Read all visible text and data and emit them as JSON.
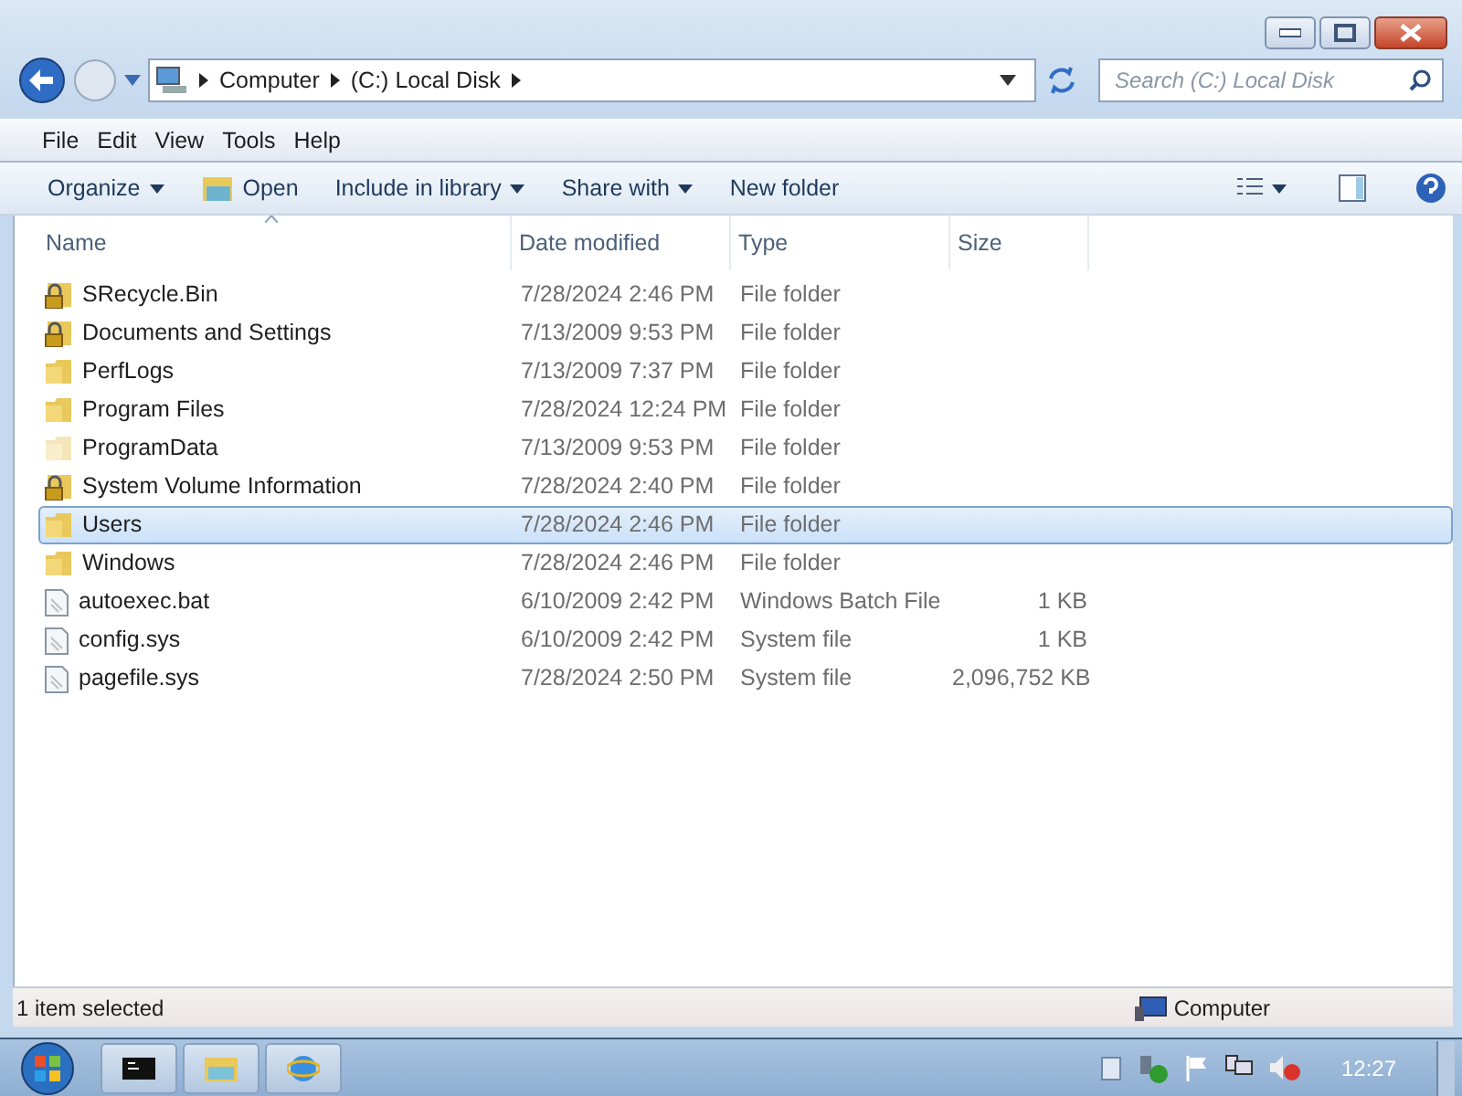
{
  "address_bar": {
    "crumbs": [
      "Computer",
      "(C:) Local Disk"
    ]
  },
  "search": {
    "placeholder": "Search (C:) Local Disk"
  },
  "menu": [
    "File",
    "Edit",
    "View",
    "Tools",
    "Help"
  ],
  "commands": [
    {
      "label": "Organize",
      "kind": "dropdown"
    },
    {
      "label": "Open",
      "kind": "open"
    },
    {
      "label": "Include in library",
      "kind": "dropdown"
    },
    {
      "label": "Share with",
      "kind": "dropdown"
    },
    {
      "label": "New folder",
      "kind": "plain"
    }
  ],
  "columns": [
    "Name",
    "Date modified",
    "Type",
    "Size"
  ],
  "rows": [
    {
      "name": "SRecycle.Bin",
      "date": "7/28/2024 2:46 PM",
      "type": "File folder",
      "kind": "locked",
      "selected": false
    },
    {
      "name": "Documents and Settings",
      "date": "7/13/2009 9:53 PM",
      "type": "File folder",
      "kind": "locked",
      "selected": false
    },
    {
      "name": "PerfLogs",
      "date": "7/13/2009 7:37 PM",
      "type": "File folder",
      "kind": "folder",
      "selected": false
    },
    {
      "name": "Program Files",
      "date": "7/28/2024 12:24 PM",
      "type": "File folder",
      "kind": "folder",
      "selected": false
    },
    {
      "name": "ProgramData",
      "date": "7/13/2009 9:53 PM",
      "type": "File folder",
      "kind": "hidden",
      "selected": false
    },
    {
      "name": "System Volume Information",
      "date": "7/28/2024 2:40 PM",
      "type": "File folder",
      "kind": "locked",
      "selected": false
    },
    {
      "name": "Users",
      "date": "7/28/2024 2:46 PM",
      "type": "File folder",
      "kind": "folder",
      "selected": true
    },
    {
      "name": "Windows",
      "date": "7/28/2024 2:46 PM",
      "type": "File folder",
      "kind": "folder",
      "selected": false
    },
    {
      "name": "autoexec.bat",
      "date": "6/10/2009 2:42 PM",
      "type": "Windows Batch File",
      "size": "1 KB",
      "kind": "file",
      "selected": false
    },
    {
      "name": "config.sys",
      "date": "6/10/2009 2:42 PM",
      "type": "System file",
      "size": "1 KB",
      "kind": "file",
      "selected": false
    },
    {
      "name": "pagefile.sys",
      "date": "7/28/2024 2:50 PM",
      "type": "System file",
      "size": "2,096,752 KB",
      "kind": "file",
      "selected": false
    }
  ],
  "status_bar": {
    "selection": "1 item selected",
    "location": "Computer"
  },
  "taskbar": {
    "clock": "12:27"
  }
}
